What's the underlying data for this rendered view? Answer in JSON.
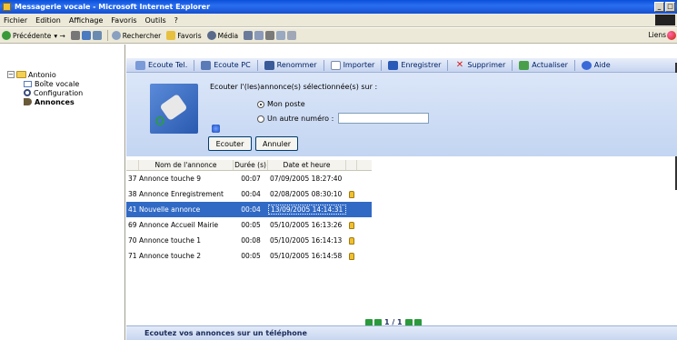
{
  "window": {
    "title": "Messagerie vocale - Microsoft Internet Explorer",
    "min_glyph": "_",
    "max_glyph": "□"
  },
  "menu": [
    "Fichier",
    "Edition",
    "Affichage",
    "Favoris",
    "Outils",
    "?"
  ],
  "toolbar": {
    "back": "Précédente",
    "search": "Rechercher",
    "favorites": "Favoris",
    "media": "Média",
    "links": "Liens"
  },
  "tree": {
    "root": "Antonio",
    "expander": "−",
    "items": [
      {
        "label": "Boîte vocale"
      },
      {
        "label": "Configuration"
      },
      {
        "label": "Annonces"
      }
    ]
  },
  "actions": [
    "Ecoute Tel.",
    "Ecoute PC",
    "Renommer",
    "Importer",
    "Enregistrer",
    "Supprimer",
    "Actualiser",
    "Aide"
  ],
  "listen": {
    "instruction": "Ecouter l'(les)annonce(s) sélectionnée(s) sur :",
    "option_mine": "Mon poste",
    "option_other": "Un autre numéro :",
    "other_number": "",
    "listen_button": "Ecouter",
    "cancel_button": "Annuler"
  },
  "table": {
    "headers": {
      "name": "Nom de l'annonce",
      "duration": "Durée (s)",
      "date": "Date et heure"
    },
    "rows": [
      {
        "id": "37",
        "name": "Annonce touche 9",
        "duration": "00:07",
        "date": "07/09/2005 18:27:40",
        "locked": false,
        "selected": false
      },
      {
        "id": "38",
        "name": "Annonce Enregistrement",
        "duration": "00:04",
        "date": "02/08/2005 08:30:10",
        "locked": true,
        "selected": false
      },
      {
        "id": "41",
        "name": "Nouvelle annonce",
        "duration": "00:04",
        "date": "13/09/2005 14:14:31",
        "locked": false,
        "selected": true
      },
      {
        "id": "69",
        "name": "Annonce Accueil Mairie",
        "duration": "00:05",
        "date": "05/10/2005 16:13:26",
        "locked": true,
        "selected": false
      },
      {
        "id": "70",
        "name": "Annonce touche 1",
        "duration": "00:08",
        "date": "05/10/2005 16:14:13",
        "locked": true,
        "selected": false
      },
      {
        "id": "71",
        "name": "Annonce touche 2",
        "duration": "00:05",
        "date": "05/10/2005 16:14:58",
        "locked": true,
        "selected": false
      }
    ]
  },
  "pager": {
    "text": "1 / 1"
  },
  "banner": "Ecoutez vos annonces sur un téléphone",
  "colors": {
    "selection": "#316ac5",
    "title_bar": "#0a4fd8",
    "panel": "#c3d5f2"
  }
}
